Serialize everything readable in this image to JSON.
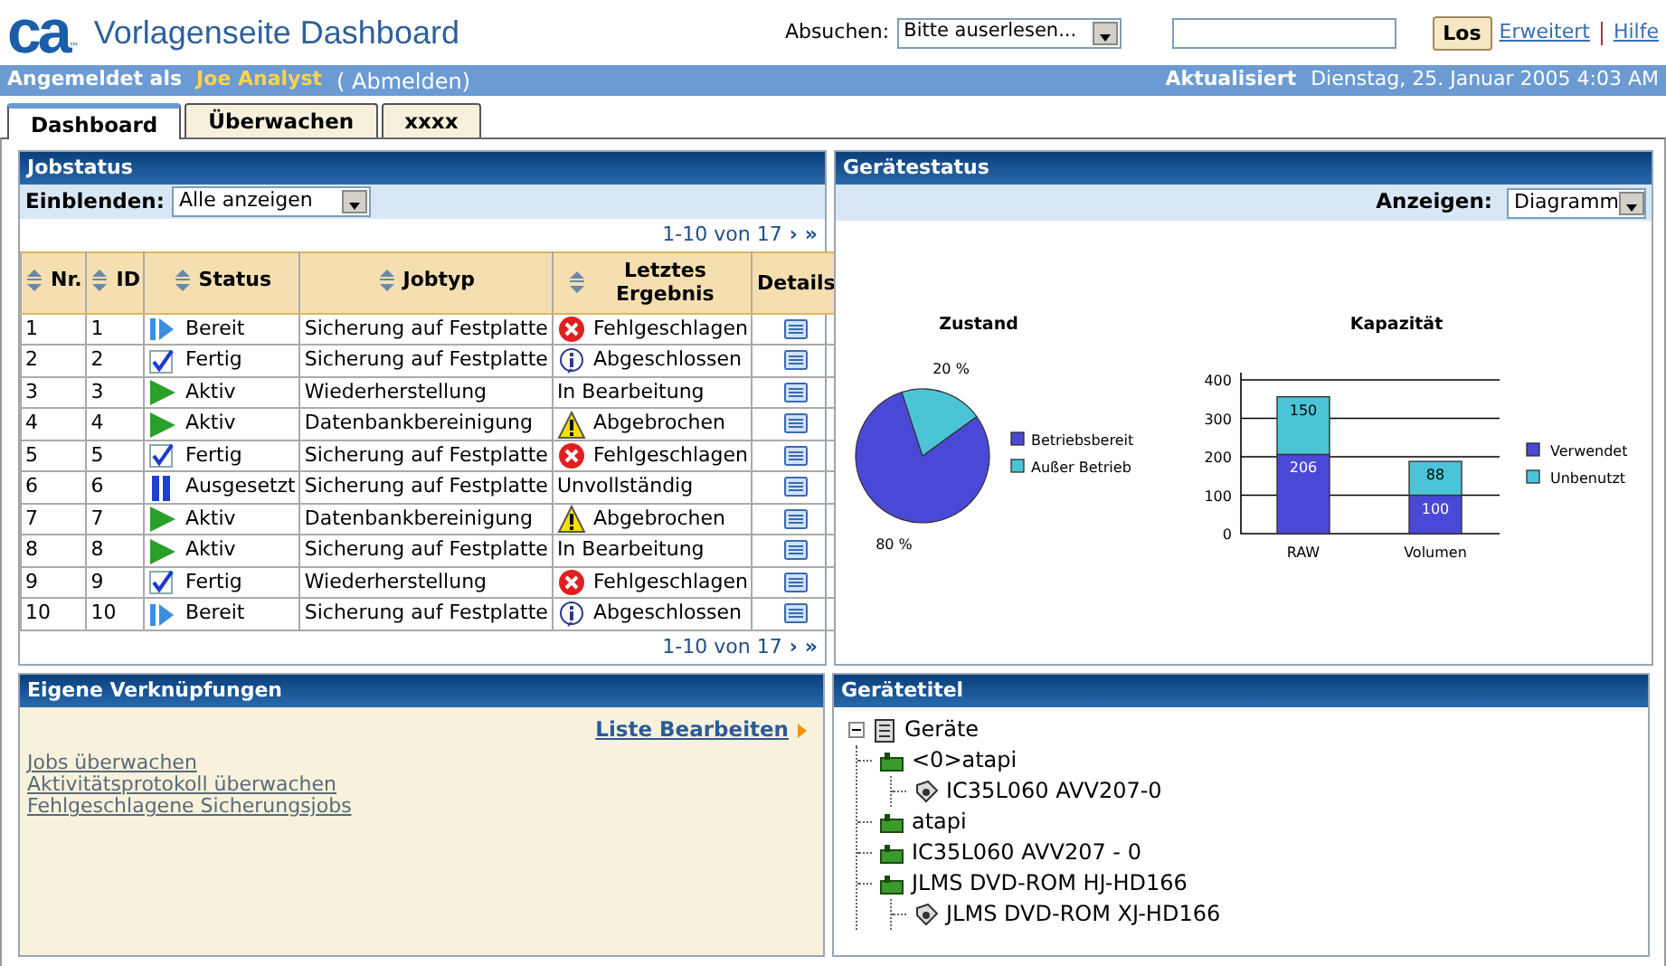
{
  "header": {
    "logo": "ca",
    "logo_mark": "™",
    "title": "Vorlagenseite Dashboard",
    "search_label": "Absuchen:",
    "search_select": "Bitte auserlesen...",
    "search_button": "Los",
    "links": [
      "Erweitert",
      "Hilfe"
    ]
  },
  "session": {
    "label": "Angemeldet als",
    "user": "Joe Analyst",
    "logout": "( Abmelden)",
    "updated_label": "Aktualisiert",
    "updated": "Dienstag, 25. Januar 2005 4:03 AM"
  },
  "tabs": [
    {
      "label": "Dashboard",
      "selected": true
    },
    {
      "label": "Überwachen",
      "selected": false
    },
    {
      "label": "xxxx",
      "selected": false
    }
  ],
  "jobstatus": {
    "title": "Jobstatus",
    "filter_label": "Einblenden:",
    "filter_value": "Alle anzeigen",
    "pager_top": {
      "text": "1-10 von 17",
      "next": "›",
      "last": "»"
    },
    "columns": [
      {
        "label": "Nr.",
        "sortable": true
      },
      {
        "label": "ID",
        "sortable": true
      },
      {
        "label": "Status",
        "sortable": true
      },
      {
        "label": "Jobtyp",
        "sortable": true
      },
      {
        "label": "Letztes Ergebnis",
        "sortable": true
      },
      {
        "label": "Details",
        "sortable": false
      }
    ],
    "rows": [
      {
        "nr": "1",
        "id": "1",
        "status": {
          "text": "Bereit",
          "kind": "ready"
        },
        "jobtyp": "Sicherung auf Festplatte",
        "result": {
          "text": "Fehlgeschlagen",
          "kind": "failed"
        }
      },
      {
        "nr": "2",
        "id": "2",
        "status": {
          "text": "Fertig",
          "kind": "done"
        },
        "jobtyp": "Sicherung auf Festplatte",
        "result": {
          "text": "Abgeschlossen",
          "kind": "info"
        }
      },
      {
        "nr": "3",
        "id": "3",
        "status": {
          "text": "Aktiv",
          "kind": "active"
        },
        "jobtyp": "Wiederherstellung",
        "result": {
          "text": "In Bearbeitung",
          "kind": "none"
        }
      },
      {
        "nr": "4",
        "id": "4",
        "status": {
          "text": "Aktiv",
          "kind": "active"
        },
        "jobtyp": "Datenbankbereinigung",
        "result": {
          "text": "Abgebrochen",
          "kind": "warning"
        }
      },
      {
        "nr": "5",
        "id": "5",
        "status": {
          "text": "Fertig",
          "kind": "done"
        },
        "jobtyp": "Sicherung auf Festplatte",
        "result": {
          "text": "Fehlgeschlagen",
          "kind": "failed"
        }
      },
      {
        "nr": "6",
        "id": "6",
        "status": {
          "text": "Ausgesetzt",
          "kind": "paused"
        },
        "jobtyp": "Sicherung auf Festplatte",
        "result": {
          "text": "Unvollständig",
          "kind": "none"
        }
      },
      {
        "nr": "7",
        "id": "7",
        "status": {
          "text": "Aktiv",
          "kind": "active"
        },
        "jobtyp": "Datenbankbereinigung",
        "result": {
          "text": "Abgebrochen",
          "kind": "warning"
        }
      },
      {
        "nr": "8",
        "id": "8",
        "status": {
          "text": "Aktiv",
          "kind": "active"
        },
        "jobtyp": "Sicherung auf Festplatte",
        "result": {
          "text": "In Bearbeitung",
          "kind": "none"
        }
      },
      {
        "nr": "9",
        "id": "9",
        "status": {
          "text": "Fertig",
          "kind": "done"
        },
        "jobtyp": "Wiederherstellung",
        "result": {
          "text": "Fehlgeschlagen",
          "kind": "failed"
        }
      },
      {
        "nr": "10",
        "id": "10",
        "status": {
          "text": "Bereit",
          "kind": "ready"
        },
        "jobtyp": "Sicherung auf Festplatte",
        "result": {
          "text": "Abgeschlossen",
          "kind": "info"
        }
      }
    ],
    "pager_bottom": {
      "text": "1-10 von 17",
      "next": "›",
      "last": "»"
    }
  },
  "devicestatus": {
    "title": "Gerätestatus",
    "view_label": "Anzeigen:",
    "view_value": "Diagramm",
    "charts": [
      {
        "chart_data": {
          "type": "pie",
          "title": "Zustand",
          "categories": [
            "Betriebsbereit",
            "Außer Betrieb"
          ],
          "values": [
            80,
            20
          ],
          "value_labels": [
            "80 %",
            "20 %"
          ],
          "legend": "right"
        }
      },
      {
        "chart_data": {
          "type": "bar",
          "title": "Kapazität",
          "categories": [
            "RAW",
            "Volumen"
          ],
          "stacked": true,
          "data_labels": true,
          "grid": true,
          "legend": "right",
          "ylim": [
            0,
            400
          ],
          "yticks": [
            0,
            100,
            200,
            300,
            400
          ],
          "series": [
            {
              "name": "Verwendet",
              "color": "#4a48d6",
              "values": [
                206,
                100
              ]
            },
            {
              "name": "Unbenutzt",
              "color": "#4cc4d8",
              "values": [
                150,
                88
              ]
            }
          ]
        }
      }
    ]
  },
  "shortcuts": {
    "title": "Eigene Verknüpfungen",
    "edit": "Liste Bearbeiten",
    "items": [
      "Jobs überwachen",
      "Aktivitätsprotokoll überwachen",
      "Fehlgeschlagene Sicherungsjobs"
    ]
  },
  "devices": {
    "title": "Gerätetitel",
    "tree": {
      "label": "Geräte",
      "kind": "root",
      "expanded": true,
      "children": [
        {
          "label": "<0>atapi",
          "kind": "disk",
          "children": [
            {
              "label": "IC35L060 AVV207-0",
              "kind": "drive"
            }
          ]
        },
        {
          "label": "atapi",
          "kind": "disk"
        },
        {
          "label": "IC35L060 AVV207 - 0",
          "kind": "disk"
        },
        {
          "label": "JLMS DVD-ROM HJ-HD166",
          "kind": "disk",
          "children": [
            {
              "label": "JLMS DVD-ROM XJ-HD166",
              "kind": "drive"
            }
          ]
        }
      ]
    }
  }
}
